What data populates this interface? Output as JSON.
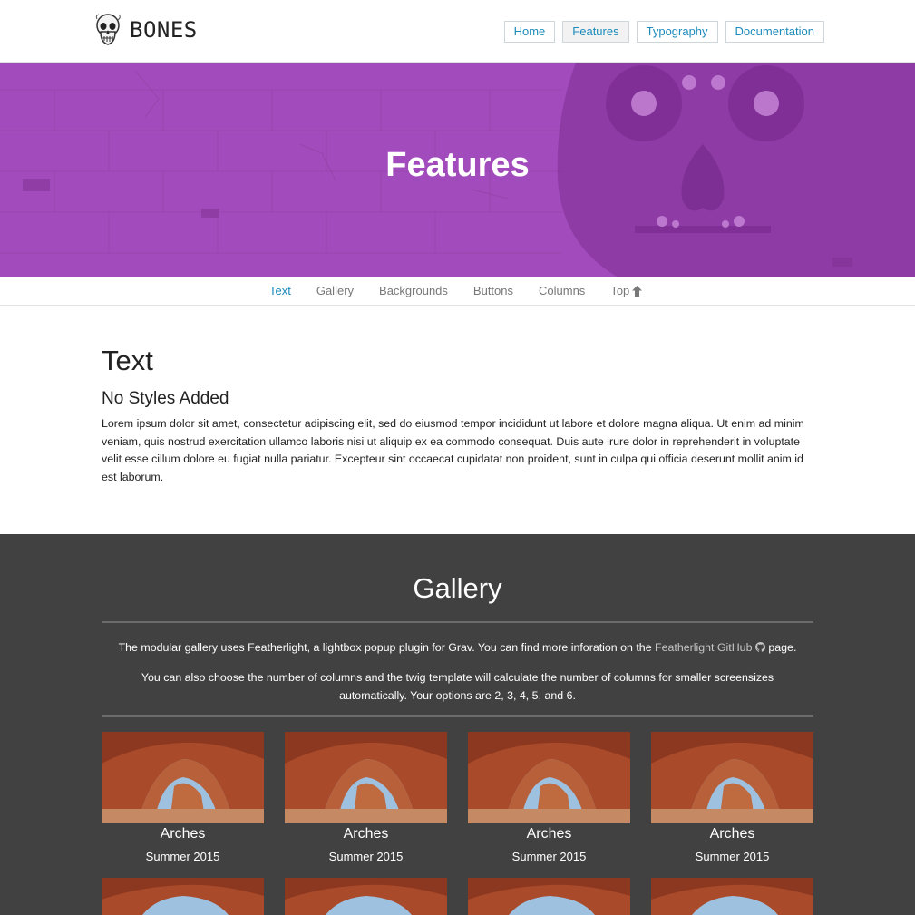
{
  "header": {
    "logo_text": "BONES",
    "nav": [
      {
        "label": "Home",
        "active": false
      },
      {
        "label": "Features",
        "active": true
      },
      {
        "label": "Typography",
        "active": false
      },
      {
        "label": "Documentation",
        "active": false
      }
    ]
  },
  "hero": {
    "title": "Features",
    "color": "#a24bbd"
  },
  "subnav": {
    "items": [
      {
        "label": "Text",
        "active": true
      },
      {
        "label": "Gallery"
      },
      {
        "label": "Backgrounds"
      },
      {
        "label": "Buttons"
      },
      {
        "label": "Columns"
      },
      {
        "label": "Top",
        "icon": "arrow-up-icon"
      }
    ]
  },
  "text_section": {
    "title": "Text",
    "subtitle": "No Styles Added",
    "body": "Lorem ipsum dolor sit amet, consectetur adipiscing elit, sed do eiusmod tempor incididunt ut labore et dolore magna aliqua. Ut enim ad minim veniam, quis nostrud exercitation ullamco laboris nisi ut aliquip ex ea commodo consequat. Duis aute irure dolor in reprehenderit in voluptate velit esse cillum dolore eu fugiat nulla pariatur. Excepteur sint occaecat cupidatat non proident, sunt in culpa qui officia deserunt mollit anim id est laborum."
  },
  "gallery": {
    "title": "Gallery",
    "intro_before": "The modular gallery uses Featherlight, a lightbox popup plugin for Grav. You can find more inforation on the ",
    "intro_link": "Featherlight GitHub",
    "intro_icon": "github-icon",
    "intro_after": " page.",
    "options_text": "You can also choose the number of columns and the twig template will calculate the number of columns for smaller screensizes automatically. Your options are 2, 3, 4, 5, and 6.",
    "items": [
      {
        "title": "Arches",
        "subtitle": "Summer 2015"
      },
      {
        "title": "Arches",
        "subtitle": "Summer 2015"
      },
      {
        "title": "Arches",
        "subtitle": "Summer 2015"
      },
      {
        "title": "Arches",
        "subtitle": "Summer 2015"
      }
    ],
    "background": "#414141"
  }
}
